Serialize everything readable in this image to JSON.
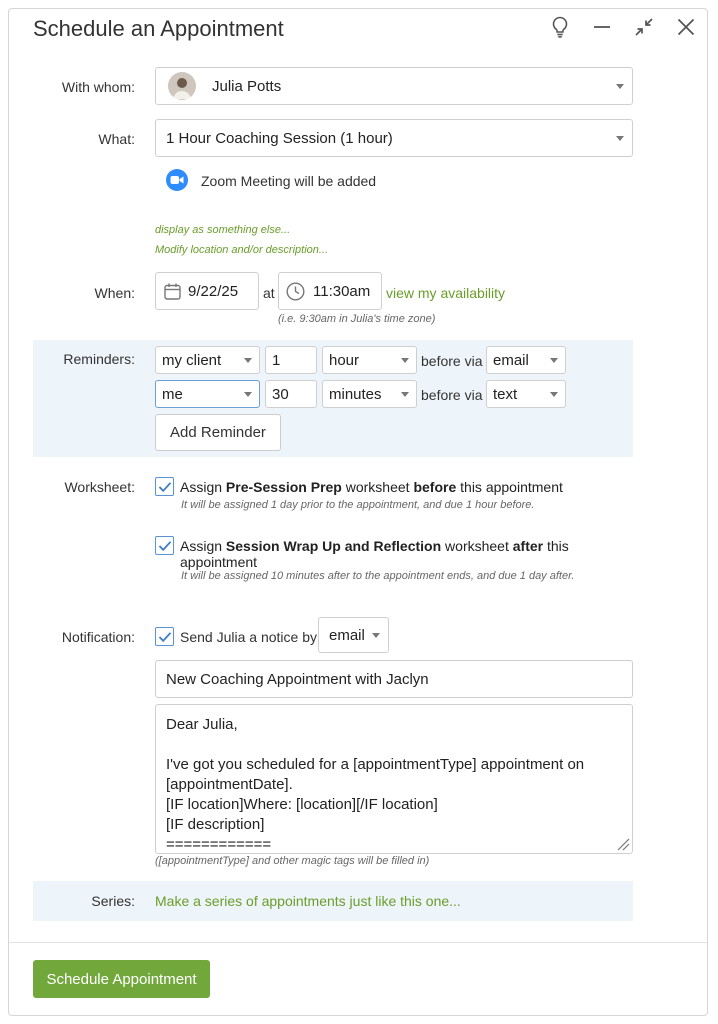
{
  "dialog": {
    "title": "Schedule an Appointment"
  },
  "with_whom": {
    "label": "With whom:",
    "value": "Julia Potts"
  },
  "what": {
    "label": "What:",
    "value": "1 Hour Coaching Session (1 hour)",
    "zoom_note": "Zoom Meeting will be added",
    "display_link": "display as something else...",
    "modify_link": "Modify location and/or description..."
  },
  "when": {
    "label": "When:",
    "date": "9/22/25",
    "at": "at",
    "time": "11:30am",
    "availability_link": "view my availability",
    "timezone_hint": "(i.e. 9:30am in Julia's time zone)"
  },
  "reminders": {
    "label": "Reminders:",
    "rows": [
      {
        "who": "my client",
        "amount": "1",
        "unit": "hour",
        "before_via": "before via",
        "method": "email"
      },
      {
        "who": "me",
        "amount": "30",
        "unit": "minutes",
        "before_via": "before via",
        "method": "text"
      }
    ],
    "add_button": "Add Reminder"
  },
  "worksheet": {
    "label": "Worksheet:",
    "items": [
      {
        "prefix": "Assign ",
        "name": "Pre-Session Prep",
        "middle": " worksheet ",
        "timing": "before",
        "suffix": " this appointment",
        "note": "It will be assigned 1 day prior to the appointment, and due 1 hour before."
      },
      {
        "prefix": "Assign ",
        "name": "Session Wrap Up and Reflection",
        "middle": " worksheet ",
        "timing": "after",
        "suffix": " this appointment",
        "note": "It will be assigned 10 minutes after to the appointment ends, and due 1 day after."
      }
    ]
  },
  "notification": {
    "label": "Notification:",
    "send_text": "Send Julia a notice by",
    "method": "email",
    "subject": "New Coaching Appointment with Jaclyn",
    "body": "Dear Julia,\n\nI've got you scheduled for a [appointmentType] appointment on [appointmentDate].\n[IF location]Where: [location][/IF location]\n[IF description]\n============",
    "magic_hint": "([appointmentType] and other magic tags will be filled in)"
  },
  "series": {
    "label": "Series:",
    "link": "Make a series of appointments just like this one..."
  },
  "footer": {
    "schedule_button": "Schedule Appointment"
  },
  "colors": {
    "accent_green": "#72a83b",
    "link_green": "#6a9d2a",
    "band_blue": "#eef5fa",
    "checkbox_blue": "#5a93d1",
    "zoom_blue": "#2d8cff"
  }
}
